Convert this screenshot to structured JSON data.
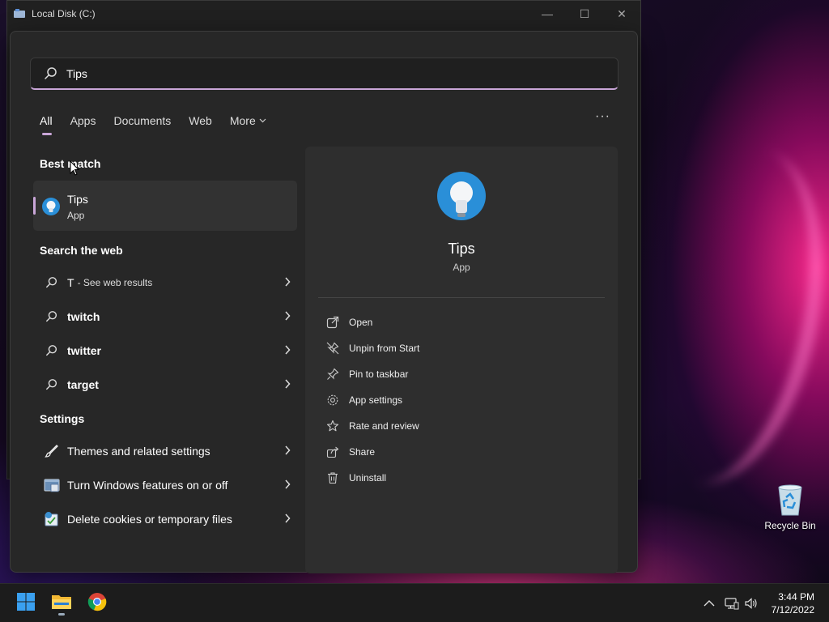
{
  "desktop": {
    "recycle_bin_label": "Recycle Bin"
  },
  "explorer_window": {
    "title": "Local Disk (C:)",
    "controls": {
      "minimize": "—",
      "maximize": "☐",
      "close": "✕"
    }
  },
  "search": {
    "query": "Tips",
    "tabs": [
      {
        "label": "All",
        "active": true
      },
      {
        "label": "Apps"
      },
      {
        "label": "Documents"
      },
      {
        "label": "Web"
      },
      {
        "label": "More"
      }
    ],
    "options_icon": "···"
  },
  "best_match": {
    "heading": "Best match",
    "name": "Tips",
    "type": "App"
  },
  "web": {
    "heading": "Search the web",
    "items": [
      {
        "label": "T",
        "sub": "- See web results"
      },
      {
        "label": "twitch"
      },
      {
        "label": "twitter"
      },
      {
        "label": "target"
      }
    ]
  },
  "settings": {
    "heading": "Settings",
    "items": [
      {
        "label": "Themes and related settings",
        "icon": "brush-icon"
      },
      {
        "label": "Turn Windows features on or off",
        "icon": "windows-features-icon"
      },
      {
        "label": "Delete cookies or temporary files",
        "icon": "internet-options-icon"
      }
    ]
  },
  "preview": {
    "name": "Tips",
    "type": "App",
    "actions": [
      {
        "label": "Open",
        "icon": "open-icon"
      },
      {
        "label": "Unpin from Start",
        "icon": "unpin-icon"
      },
      {
        "label": "Pin to taskbar",
        "icon": "pin-icon"
      },
      {
        "label": "App settings",
        "icon": "gear-icon"
      },
      {
        "label": "Rate and review",
        "icon": "star-icon"
      },
      {
        "label": "Share",
        "icon": "share-icon"
      },
      {
        "label": "Uninstall",
        "icon": "trash-icon"
      }
    ]
  },
  "taskbar": {
    "apps": [
      "start-icon",
      "file-explorer-icon",
      "chrome-icon"
    ],
    "tray": {
      "chevron": "^"
    },
    "clock": {
      "time": "3:44 PM",
      "date": "7/12/2022"
    }
  },
  "colors": {
    "accent": "#c9a6d8",
    "panel": "#272727",
    "preview": "#2e2e2e"
  }
}
